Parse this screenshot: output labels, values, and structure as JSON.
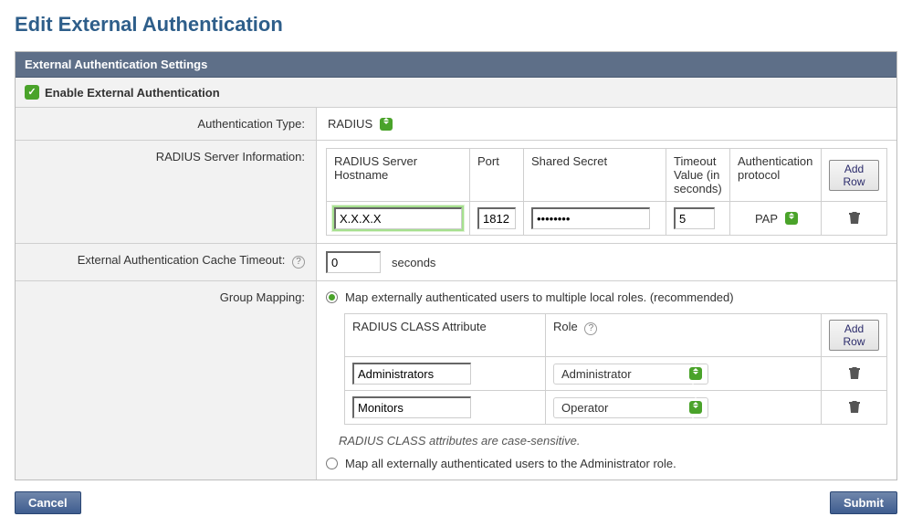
{
  "page_title": "Edit External Authentication",
  "panel_header": "External Authentication Settings",
  "enable": {
    "checked": true,
    "label": "Enable External Authentication"
  },
  "labels": {
    "auth_type": "Authentication Type:",
    "radius_info": "RADIUS Server Information:",
    "cache_timeout": "External Authentication Cache Timeout:",
    "group_mapping": "Group Mapping:",
    "seconds": "seconds"
  },
  "auth_type_value": "RADIUS",
  "radius_table": {
    "headers": {
      "hostname": "RADIUS Server Hostname",
      "port": "Port",
      "secret": "Shared Secret",
      "timeout": "Timeout Value (in seconds)",
      "protocol": "Authentication protocol",
      "add_row": "Add Row"
    },
    "row": {
      "hostname": "X.X.X.X",
      "port": "1812",
      "secret": "••••••••",
      "timeout": "5",
      "protocol": "PAP"
    }
  },
  "cache_timeout_value": "0",
  "group_mapping": {
    "option_multiple": "Map externally authenticated users to multiple local roles. (recommended)",
    "option_admin": "Map all externally authenticated users to the Administrator role.",
    "selected": "multiple",
    "table_headers": {
      "class_attr": "RADIUS CLASS Attribute",
      "role": "Role",
      "add_row": "Add Row"
    },
    "rows": [
      {
        "attr": "Administrators",
        "role": "Administrator"
      },
      {
        "attr": "Monitors",
        "role": "Operator"
      }
    ],
    "note": "RADIUS CLASS attributes are case-sensitive."
  },
  "buttons": {
    "cancel": "Cancel",
    "submit": "Submit"
  }
}
